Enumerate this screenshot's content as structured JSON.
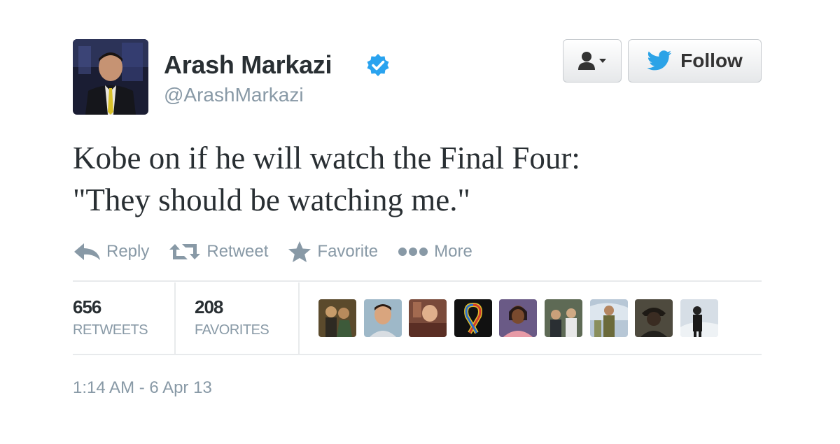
{
  "user": {
    "name": "Arash Markazi",
    "handle": "@ArashMarkazi",
    "verified_icon": "verified-badge-icon"
  },
  "header_buttons": {
    "user_menu_icon": "user-dropdown-icon",
    "follow_label": "Follow",
    "follow_icon": "twitter-bird-icon"
  },
  "tweet": {
    "lines": [
      "Kobe on if he will watch the Final Four:",
      "\"They should be watching me.\""
    ]
  },
  "actions": [
    {
      "label": "Reply",
      "icon": "reply-icon"
    },
    {
      "label": "Retweet",
      "icon": "retweet-icon"
    },
    {
      "label": "Favorite",
      "icon": "star-icon"
    },
    {
      "label": "More",
      "icon": "more-dots-icon"
    }
  ],
  "stats": {
    "retweets": {
      "count": "656",
      "label": "RETWEETS"
    },
    "favorites": {
      "count": "208",
      "label": "FAVORITES"
    }
  },
  "favoriters_avatars": 9,
  "timestamp": "1:14 AM - 6 Apr 13",
  "colors": {
    "text": "#292f33",
    "muted": "#8899a6",
    "verified": "#1da1f2",
    "twitter_blue": "#2ca3e7"
  }
}
